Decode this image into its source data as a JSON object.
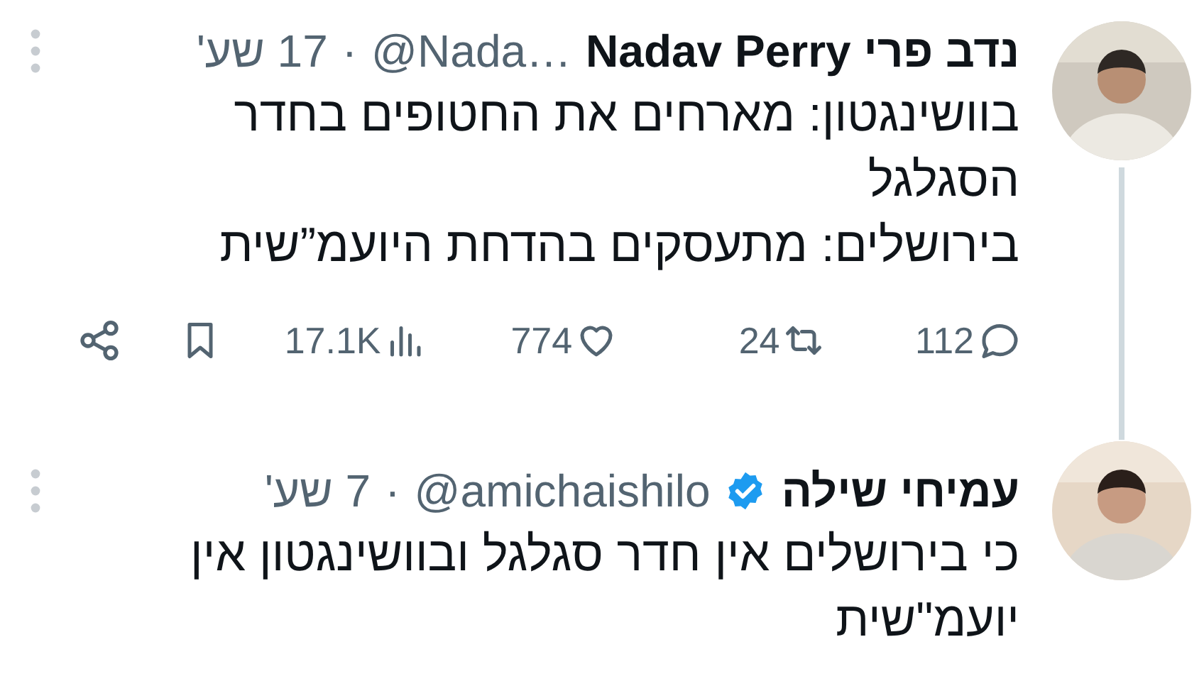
{
  "tweets": [
    {
      "name": "נדב פרי Nadav Perry",
      "verified": false,
      "handle": "@Nada…",
      "separator": "·",
      "time": "17 שע'",
      "thread_line": true,
      "paragraphs": [
        "בוושינגטון: מארחים את החטופים בחדר הסגלגל",
        "בירושלים: מתעסקים בהדחת היועמ”שית"
      ],
      "stats": {
        "replies": "112",
        "reposts": "24",
        "likes": "774",
        "views": "17.1K"
      }
    },
    {
      "name": "עמיחי שילה",
      "verified": true,
      "handle": "@amichaishilo",
      "separator": "·",
      "time": "7 שע'",
      "thread_line": false,
      "paragraphs": [
        "כי בירושלים אין חדר סגלגל ובוושינגטון אין יועמ\"שית"
      ]
    }
  ]
}
